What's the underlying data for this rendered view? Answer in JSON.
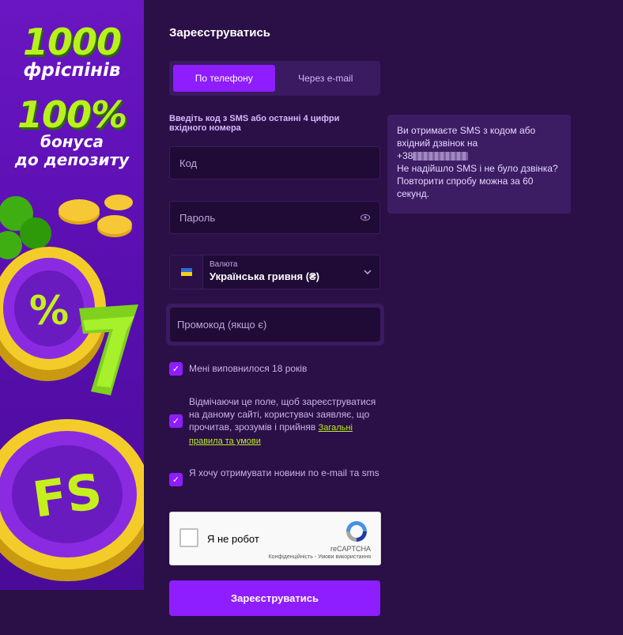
{
  "promo": {
    "headline_big": "1000",
    "headline_sub": "фріспінів",
    "bonus_big": "100%",
    "bonus_sub_line1": "бонуса",
    "bonus_sub_line2": "до депозиту",
    "accent_color": "#b9f11d"
  },
  "form": {
    "title": "Зареєструватись",
    "tabs": [
      {
        "label": "По телефону",
        "active": true
      },
      {
        "label": "Через e-mail",
        "active": false
      }
    ],
    "hint": "Введіть код з SMS або останні 4 цифри вхідного номера",
    "code_placeholder": "Код",
    "password_placeholder": "Пароль",
    "currency": {
      "label": "Валюта",
      "value": "Українська гривня (₴)"
    },
    "promo_placeholder": "Промокод (якщо є)",
    "checkboxes": [
      {
        "text": "Мені виповнилося 18 років",
        "checked": true
      },
      {
        "text": "Відмічаючи це поле, щоб зареєструватися на даному сайті, користувач заявляє, що прочитав, зрозумів і прийняв",
        "link": "Загальні правила та умови",
        "checked": true
      },
      {
        "text": "Я хочу отримувати новини по e-mail та sms",
        "checked": true
      }
    ],
    "recaptcha": {
      "label": "Я не робот",
      "brand": "reCAPTCHA",
      "terms": "Конфіденційність - Умови використання"
    },
    "submit_label": "Зареєструватись"
  },
  "sms_notice": {
    "line1": "Ви отримаєте SMS з кодом або вхідний дзвінок на",
    "phone_prefix": "+38",
    "line2": "Не надійшло SMS і не було дзвінка? Повторити спробу можна за 60 секунд."
  },
  "colors": {
    "primary": "#8e1dff",
    "background": "#2b0f47",
    "field_bg": "#1f0b36"
  }
}
